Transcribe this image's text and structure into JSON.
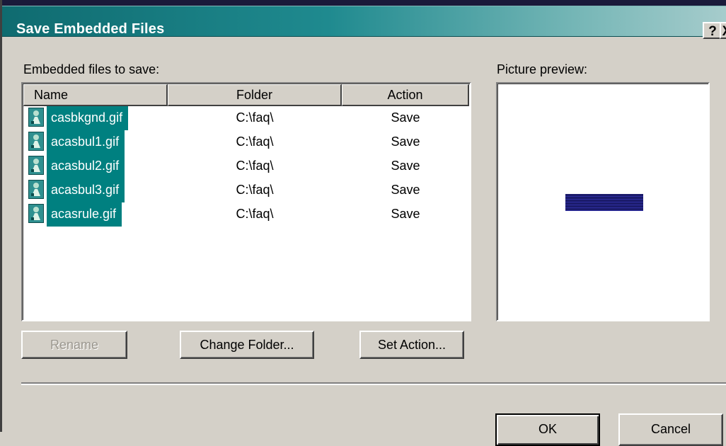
{
  "window": {
    "title": "Save Embedded Files",
    "help_button": "?",
    "close_button": "X"
  },
  "files_label": "Embedded files to save:",
  "preview_label": "Picture preview:",
  "columns": {
    "name": "Name",
    "folder": "Folder",
    "action": "Action"
  },
  "rows": [
    {
      "name": "casbkgnd.gif",
      "folder": "C:\\faq\\",
      "action": "Save",
      "icon": "image-file-icon",
      "selected": true
    },
    {
      "name": "acasbul1.gif",
      "folder": "C:\\faq\\",
      "action": "Save",
      "icon": "image-file-icon",
      "selected": true
    },
    {
      "name": "acasbul2.gif",
      "folder": "C:\\faq\\",
      "action": "Save",
      "icon": "image-file-icon",
      "selected": true
    },
    {
      "name": "acasbul3.gif",
      "folder": "C:\\faq\\",
      "action": "Save",
      "icon": "image-file-icon",
      "selected": true
    },
    {
      "name": "acasrule.gif",
      "folder": "C:\\faq\\",
      "action": "Save",
      "icon": "image-file-icon",
      "selected": true
    }
  ],
  "buttons": {
    "rename": "Rename",
    "change_folder": "Change Folder...",
    "set_action": "Set Action...",
    "ok": "OK",
    "cancel": "Cancel"
  },
  "colors": {
    "selection": "#008080",
    "dialog_face": "#d4d0c8",
    "preview_rule": "#1b1b6b"
  }
}
